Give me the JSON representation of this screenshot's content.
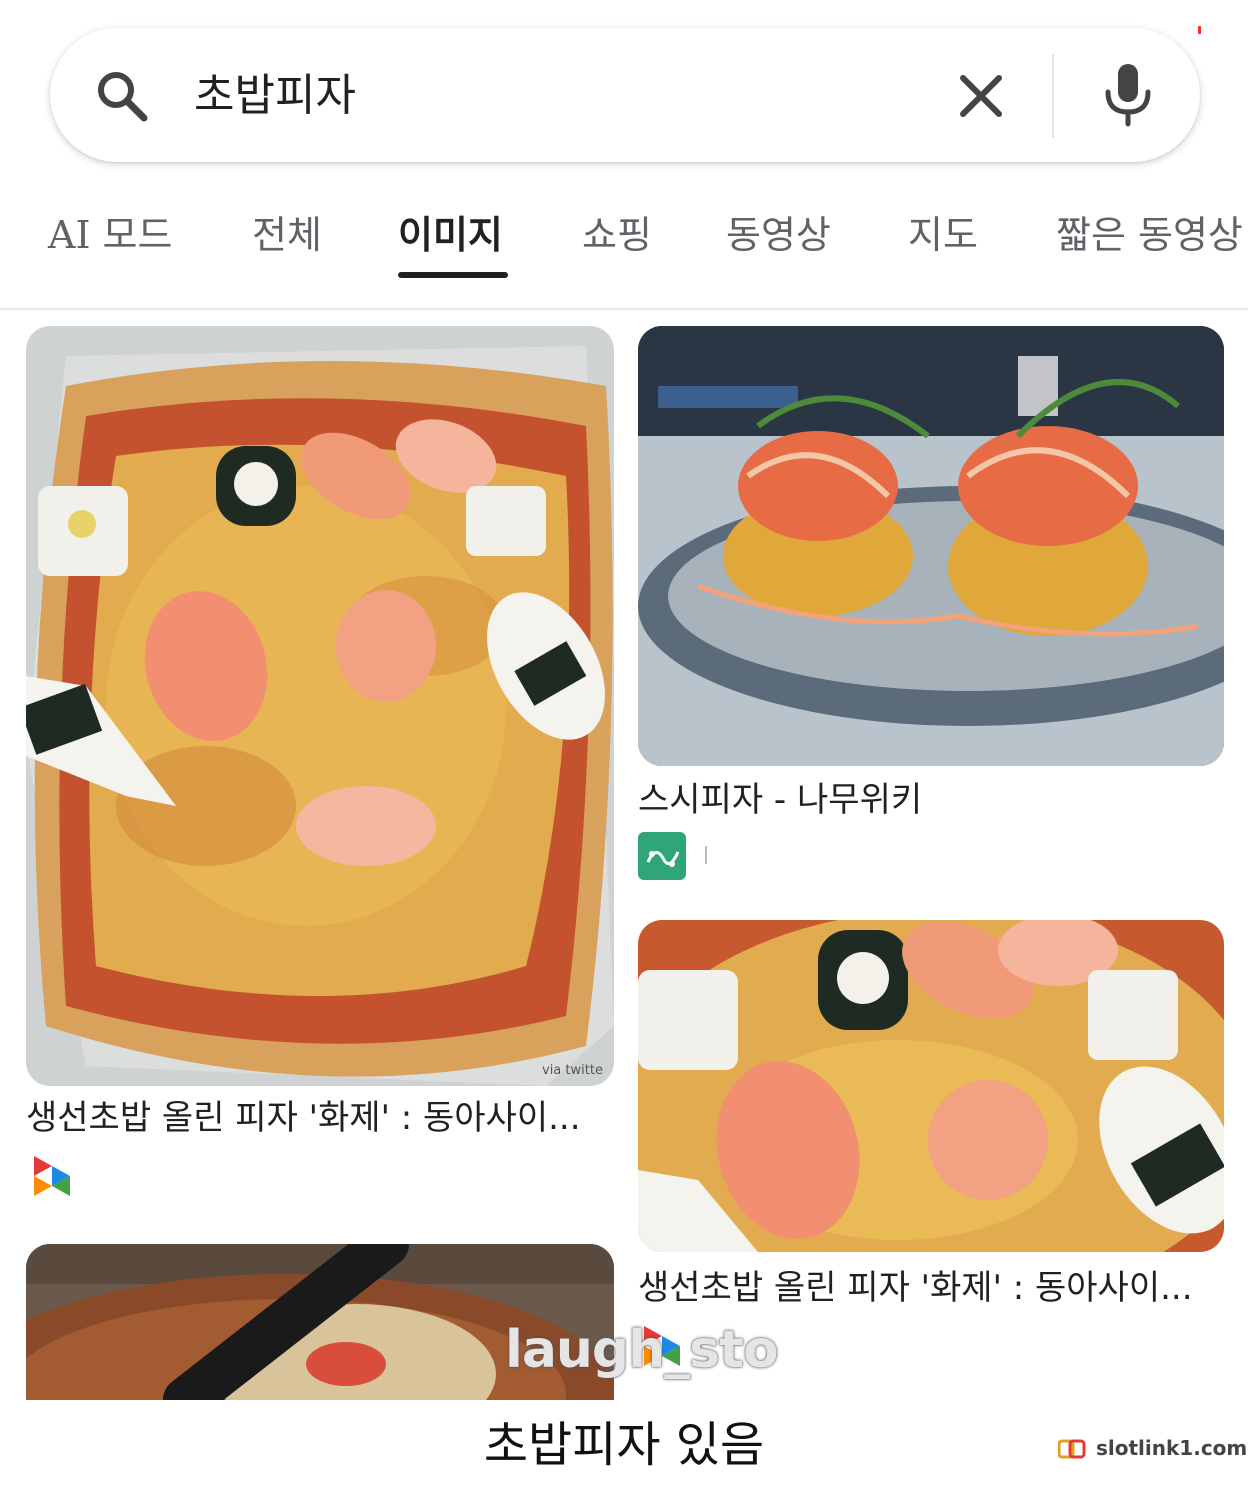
{
  "search": {
    "query": "초밥피자",
    "icons": [
      "search-icon",
      "clear-icon",
      "mic-icon"
    ]
  },
  "tabs": [
    {
      "label": "AI 모드",
      "active": false
    },
    {
      "label": "전체",
      "active": false
    },
    {
      "label": "이미지",
      "active": true
    },
    {
      "label": "쇼핑",
      "active": false
    },
    {
      "label": "동영상",
      "active": false
    },
    {
      "label": "지도",
      "active": false
    },
    {
      "label": "짧은 동영상",
      "active": false
    }
  ],
  "results": [
    {
      "caption": "생선초밥 올린 피자 '화제' : 동아사이...",
      "source_icon": "donga-logo",
      "image_text": "via twitte"
    },
    {
      "caption": "스시피자 - 나무위키",
      "source_icon": "namuwiki-logo"
    },
    {
      "caption": "생선초밥 올린 피자 '화제' : 동아사이...",
      "source_icon": "donga-logo"
    }
  ],
  "overlay": {
    "watermark": "laugh_sto",
    "bottom_caption": "초밥피자 있음",
    "site": "slotlink1.com"
  },
  "colors": {
    "accent": "#202124",
    "muted": "#5f6368",
    "namu_green": "#2fa57a"
  }
}
